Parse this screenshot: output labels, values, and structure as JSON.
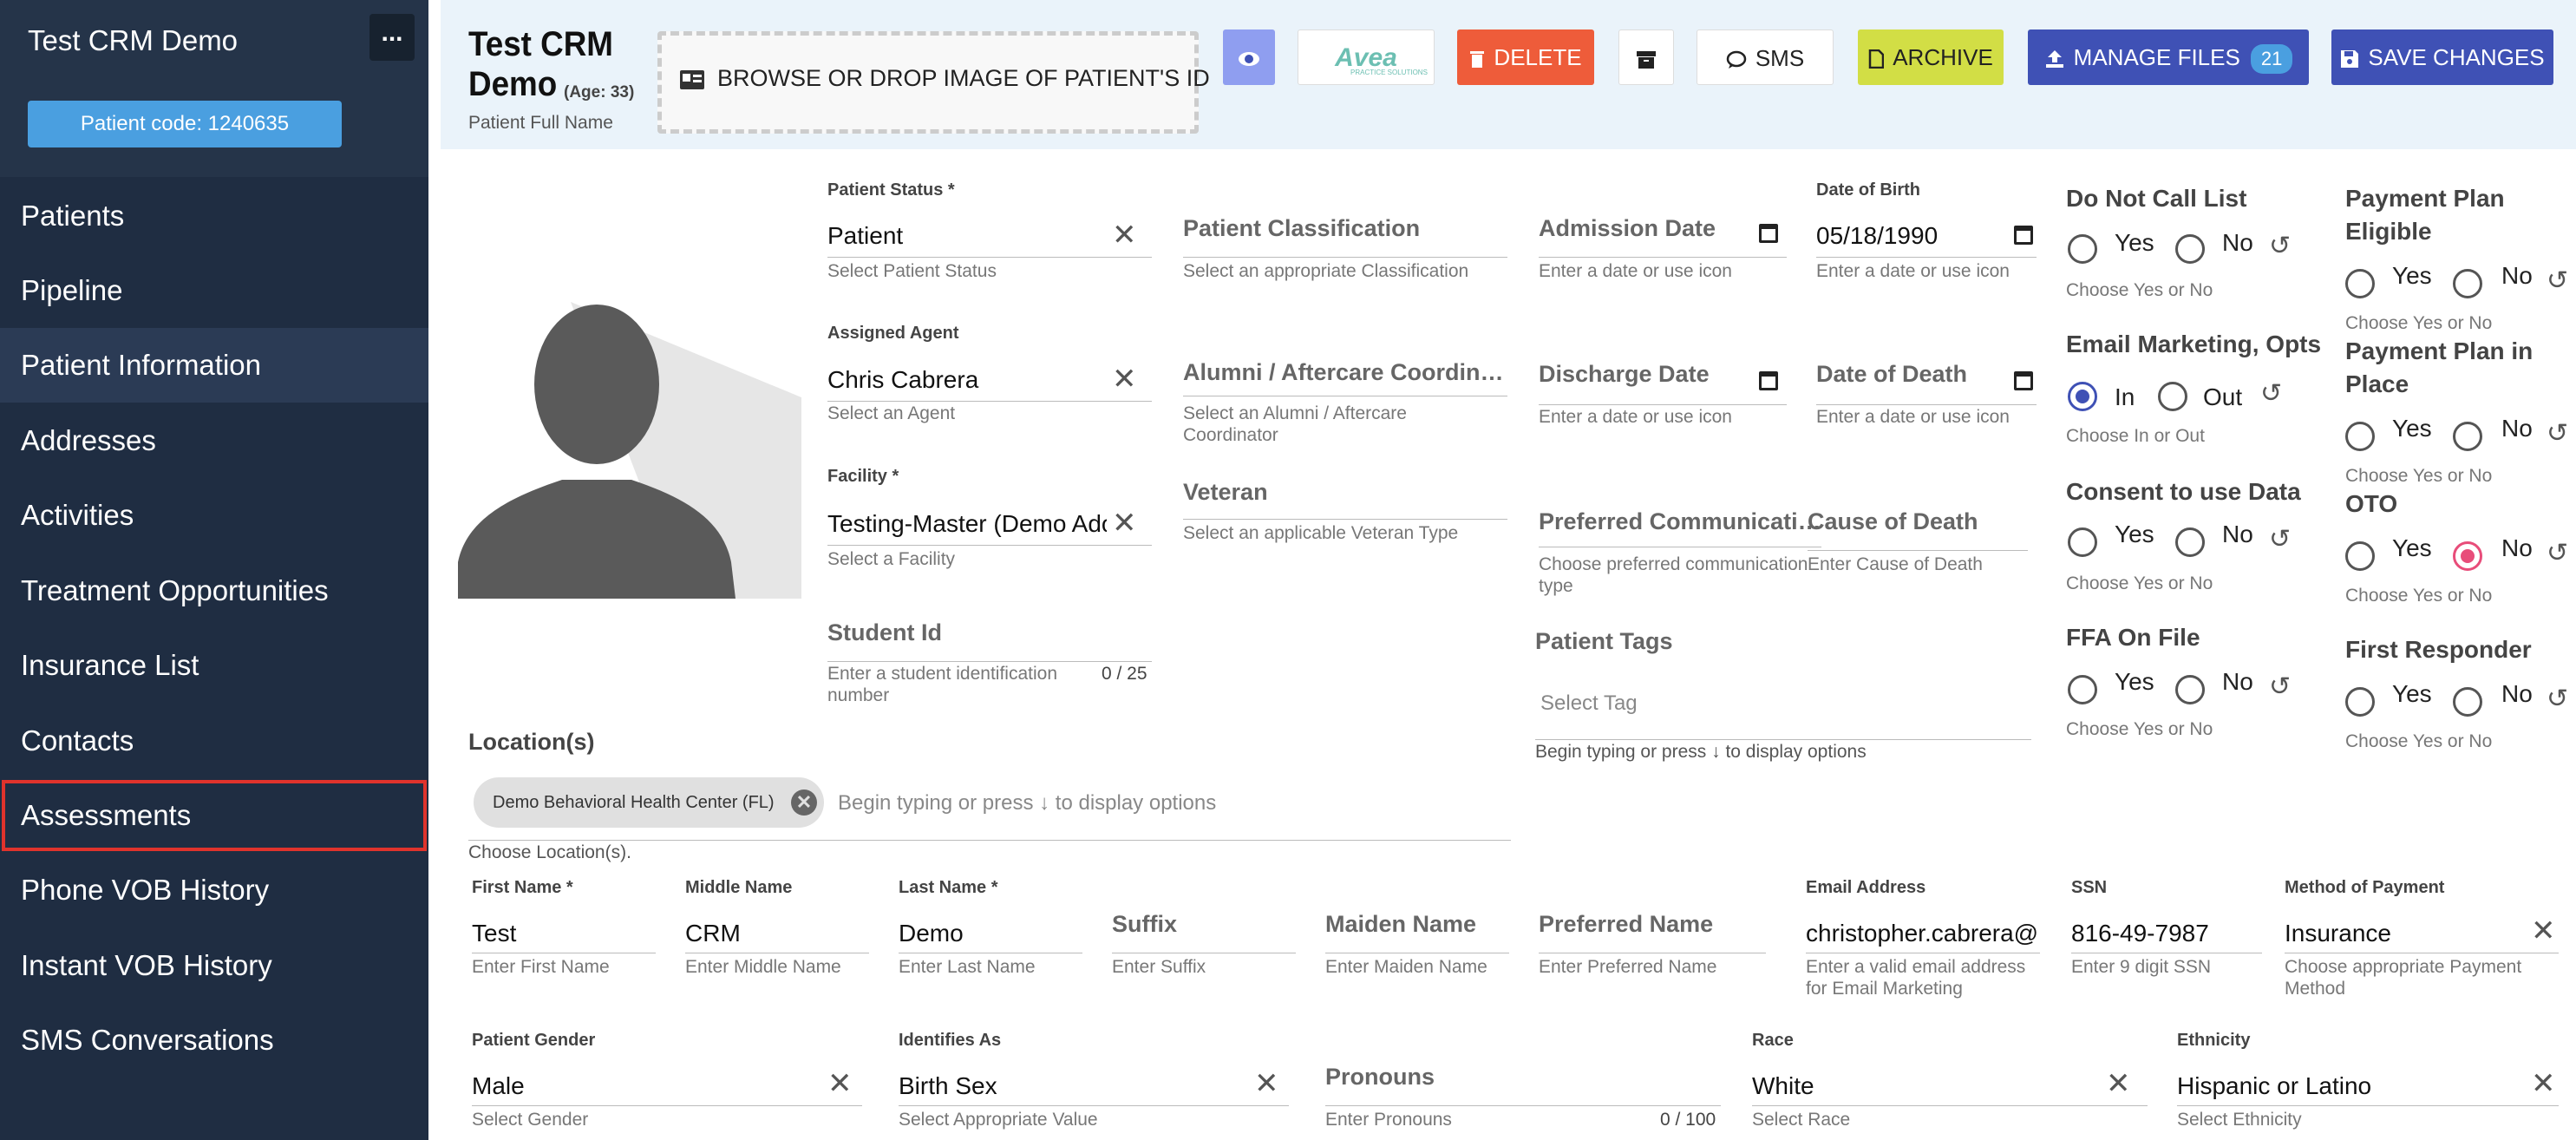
{
  "sidebar": {
    "app_title": "Test CRM Demo",
    "more_label": "...",
    "patient_code": "Patient code: 1240635",
    "items": [
      {
        "label": "Patients"
      },
      {
        "label": "Pipeline"
      },
      {
        "label": "Patient Information"
      },
      {
        "label": "Addresses"
      },
      {
        "label": "Activities"
      },
      {
        "label": "Treatment Opportunities"
      },
      {
        "label": "Insurance List"
      },
      {
        "label": "Contacts"
      },
      {
        "label": "Assessments"
      },
      {
        "label": "Phone VOB History"
      },
      {
        "label": "Instant VOB History"
      },
      {
        "label": "SMS Conversations"
      }
    ]
  },
  "header": {
    "patient_name": "Test CRM Demo",
    "age": "(Age: 33)",
    "name_label": "Patient Full Name",
    "browse": "BROWSE OR DROP IMAGE OF PATIENT'S ID",
    "avea": "Avea",
    "avea_sub": "PRACTICE SOLUTIONS",
    "delete": "DELETE",
    "sms": "SMS",
    "archive": "ARCHIVE",
    "manage_files": "MANAGE FILES",
    "files_count": "21",
    "save": "SAVE CHANGES"
  },
  "colors": {
    "sidebar": "#1f2d42",
    "delete": "#ee5c3a",
    "archive": "#d2de45",
    "primary": "#3f51b5",
    "accent": "#4a9fe0"
  },
  "fields": {
    "patient_status": {
      "label": "Patient Status *",
      "value": "Patient",
      "help": "Select Patient Status"
    },
    "assigned_agent": {
      "label": "Assigned Agent",
      "value": "Chris Cabrera",
      "help": "Select an Agent"
    },
    "facility": {
      "label": "Facility *",
      "value": "Testing-Master (Demo Ado",
      "help": "Select a Facility"
    },
    "student_id": {
      "label": "Student Id",
      "help": "Enter a student identification number",
      "counter": "0 / 25"
    },
    "classification": {
      "label": "Patient Classification",
      "help": "Select an appropriate Classification"
    },
    "alumni": {
      "label": "Alumni / Aftercare Coordin…",
      "help": "Select an Alumni / Aftercare Coordinator"
    },
    "veteran": {
      "label": "Veteran",
      "help": "Select an applicable Veteran Type"
    },
    "admission": {
      "label": "Admission Date",
      "help": "Enter a date or use icon"
    },
    "discharge": {
      "label": "Discharge Date",
      "help": "Enter a date or use icon"
    },
    "preferred_comm": {
      "label": "Preferred Communicati…",
      "help": "Choose preferred communication type"
    },
    "dob": {
      "label": "Date of Birth",
      "value": "05/18/1990",
      "help": "Enter a date or use icon"
    },
    "dod": {
      "label": "Date of Death",
      "help": "Enter a date or use icon"
    },
    "cause_death": {
      "label": "Cause of Death",
      "help": "Enter Cause of Death"
    },
    "tags": {
      "label": "Patient Tags",
      "placeholder": "Select Tag",
      "help": "Begin typing or press ↓ to display options"
    },
    "locations": {
      "label": "Location(s)",
      "chip": "Demo Behavioral Health Center (FL)",
      "placeholder": "Begin typing or press ↓ to display options",
      "help": "Choose Location(s)."
    }
  },
  "radios": {
    "dnc": {
      "label": "Do Not Call List",
      "yes": "Yes",
      "no": "No",
      "help": "Choose Yes or No"
    },
    "email": {
      "label": "Email Marketing, Opts",
      "yes": "In",
      "no": "Out",
      "help": "Choose In or Out"
    },
    "consent": {
      "label": "Consent to use Data",
      "yes": "Yes",
      "no": "No",
      "help": "Choose Yes or No"
    },
    "ffa": {
      "label": "FFA On File",
      "yes": "Yes",
      "no": "No",
      "help": "Choose Yes or No"
    },
    "ppe": {
      "label1": "Payment Plan",
      "label2": "Eligible",
      "yes": "Yes",
      "no": "No",
      "help": "Choose Yes or No"
    },
    "ppp": {
      "label1": "Payment Plan in",
      "label2": "Place",
      "yes": "Yes",
      "no": "No",
      "help": "Choose Yes or No"
    },
    "oto": {
      "label": "OTO",
      "yes": "Yes",
      "no": "No",
      "help": "Choose Yes or No"
    },
    "first_responder": {
      "label": "First Responder",
      "yes": "Yes",
      "no": "No",
      "help": "Choose Yes or No"
    }
  },
  "row1": {
    "first": {
      "label": "First Name *",
      "value": "Test",
      "help": "Enter First Name"
    },
    "middle": {
      "label": "Middle Name",
      "value": "CRM",
      "help": "Enter Middle Name"
    },
    "last": {
      "label": "Last Name *",
      "value": "Demo",
      "help": "Enter Last Name"
    },
    "suffix": {
      "label": "Suffix",
      "help": "Enter Suffix"
    },
    "maiden": {
      "label": "Maiden Name",
      "help": "Enter Maiden Name"
    },
    "preferred": {
      "label": "Preferred Name",
      "help": "Enter Preferred Name"
    },
    "email": {
      "label": "Email Address",
      "value": "christopher.cabrera@k",
      "help": "Enter a valid email address for Email Marketing"
    },
    "ssn": {
      "label": "SSN",
      "value": "816-49-7987",
      "help": "Enter 9 digit SSN"
    },
    "payment": {
      "label": "Method of Payment",
      "value": "Insurance",
      "help": "Choose appropriate Payment Method"
    }
  },
  "row2": {
    "gender": {
      "label": "Patient Gender",
      "value": "Male",
      "help": "Select Gender"
    },
    "identifies": {
      "label": "Identifies As",
      "value": "Birth Sex",
      "help": "Select Appropriate Value"
    },
    "pronouns": {
      "label": "Pronouns",
      "help": "Enter Pronouns",
      "counter": "0 / 100"
    },
    "race": {
      "label": "Race",
      "value": "White",
      "help": "Select Race"
    },
    "ethnicity": {
      "label": "Ethnicity",
      "value": "Hispanic or Latino",
      "help": "Select Ethnicity"
    }
  }
}
